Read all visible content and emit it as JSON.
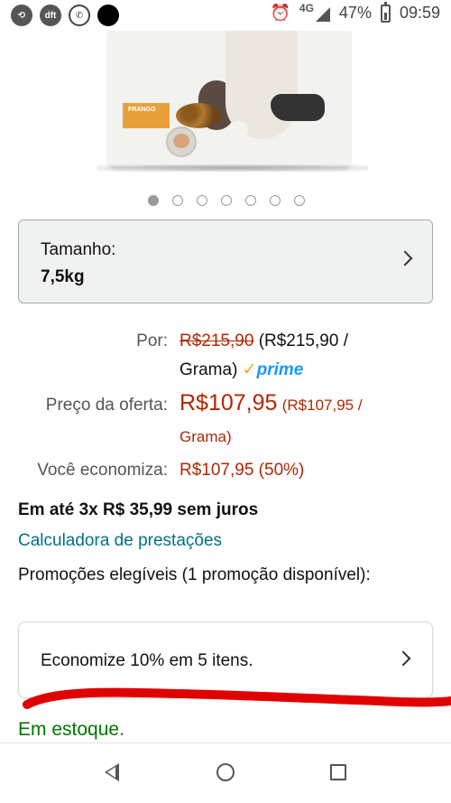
{
  "status_bar": {
    "carrier_icon": "dft",
    "network": "4G",
    "battery": "47%",
    "time": "09:59",
    "icons": [
      "data-saver-icon",
      "dft-app-icon",
      "whatsapp-icon",
      "dot-icon",
      "alarm-icon",
      "signal-icon",
      "battery-icon"
    ]
  },
  "product_image": {
    "flavor_label": "FRANGO",
    "carousel_count": 7,
    "carousel_active_index": 0
  },
  "size_selector": {
    "label": "Tamanho:",
    "value": "7,5kg",
    "icon": "chevron-right-icon"
  },
  "price": {
    "list_label": "Por:",
    "list_price": "R$215,90",
    "list_unit_line1": "(R$215,90 /",
    "list_unit_line2": "Grama)",
    "prime_check": "✓",
    "prime_word": "prime",
    "offer_label": "Preço da oferta:",
    "offer_price": "R$107,95",
    "offer_unit_line1": "(R$107,95 /",
    "offer_unit_line2": "Grama)",
    "savings_label": "Você economiza:",
    "savings_value": "R$107,95 (50%)"
  },
  "installments": "Em até 3x R$ 35,99 sem juros",
  "calculator_link": "Calculadora de prestações",
  "promotions_text": "Promoções elegíveis   (1 promoção disponível):",
  "promotion": {
    "text": "Economize 10% em 5 itens.",
    "icon": "chevron-right-icon"
  },
  "stock": "Em estoque.",
  "colors": {
    "price_red": "#b12704",
    "link_teal": "#007185",
    "stock_green": "#007600",
    "prime_blue": "#1a98ff",
    "annotation_red": "#e00000"
  },
  "navbar": {
    "icons": [
      "back-icon",
      "home-icon",
      "recents-icon"
    ]
  }
}
